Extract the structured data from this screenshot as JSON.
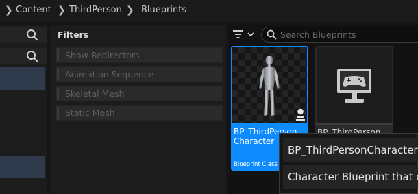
{
  "breadcrumb": {
    "items": [
      {
        "label": "Content"
      },
      {
        "label": "ThirdPerson"
      },
      {
        "label": "Blueprints"
      }
    ]
  },
  "filters": {
    "title": "Filters",
    "items": [
      {
        "label": "Show Redirectors"
      },
      {
        "label": "Animation Sequence"
      },
      {
        "label": "Skeletal Mesh"
      },
      {
        "label": "Static Mesh"
      }
    ]
  },
  "search": {
    "placeholder": "Search Blueprints"
  },
  "assets": [
    {
      "name_line1": "BP_ThirdPerson",
      "name_line2": "Character",
      "type": "Blueprint Class",
      "selected": true,
      "icon": "mannequin-thumbnail"
    },
    {
      "name_line1": "BP_ThirdPerson",
      "selected": false,
      "icon": "gamepad-monitor-icon"
    }
  ],
  "tooltip": {
    "title": "BP_ThirdPersonCharacter",
    "description": "Character Blueprint that co"
  },
  "colors": {
    "selection": "#0e8cff",
    "background": "#151515",
    "panel": "#1c1c1c"
  }
}
